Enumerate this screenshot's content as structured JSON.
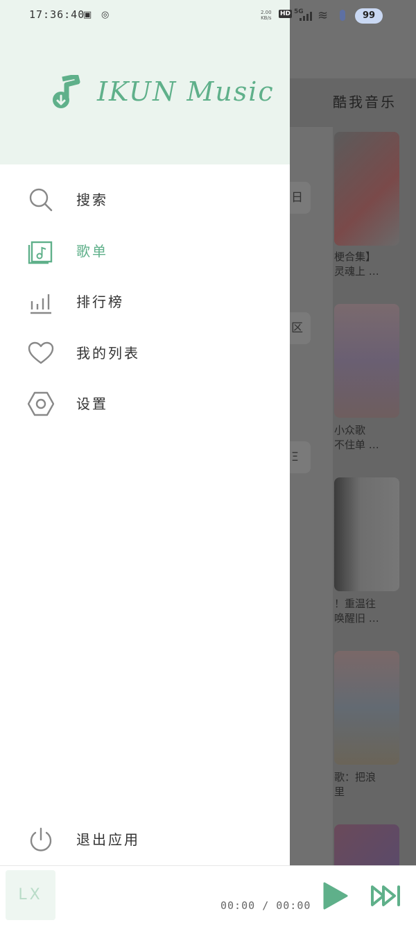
{
  "status_bar": {
    "time": "17:36:40",
    "net_speed_value": "2.00",
    "net_speed_unit": "KB/s",
    "hd": "HD",
    "network": "5G",
    "battery": "99"
  },
  "drawer": {
    "app_name": "IKUN Music",
    "menu": [
      {
        "label": "搜索",
        "icon": "search-icon",
        "active": false
      },
      {
        "label": "歌单",
        "icon": "playlist-icon",
        "active": true
      },
      {
        "label": "排行榜",
        "icon": "leaderboard-icon",
        "active": false
      },
      {
        "label": "我的列表",
        "icon": "heart-icon",
        "active": false
      },
      {
        "label": "设置",
        "icon": "settings-icon",
        "active": false
      }
    ],
    "exit_label": "退出应用"
  },
  "background_page": {
    "title": "酷我音乐",
    "chips": [
      "日",
      "区",
      "Ξ"
    ],
    "captions": [
      {
        "line1": "梗合集】",
        "line2": "灵魂上 …"
      },
      {
        "line1": "小众歌",
        "line2": "不住单 …"
      },
      {
        "line1": "！重温往",
        "line2": "唤醒旧 …"
      },
      {
        "line1": "歌：把浪",
        "line2": "里"
      }
    ]
  },
  "player": {
    "cover_text": "LX",
    "current_time": "00:00",
    "separator": "/",
    "total_time": "00:00"
  },
  "colors": {
    "accent": "#5fb08a",
    "drawer_header_bg": "#ebf4ee",
    "overlay": "#5a5a5a"
  }
}
